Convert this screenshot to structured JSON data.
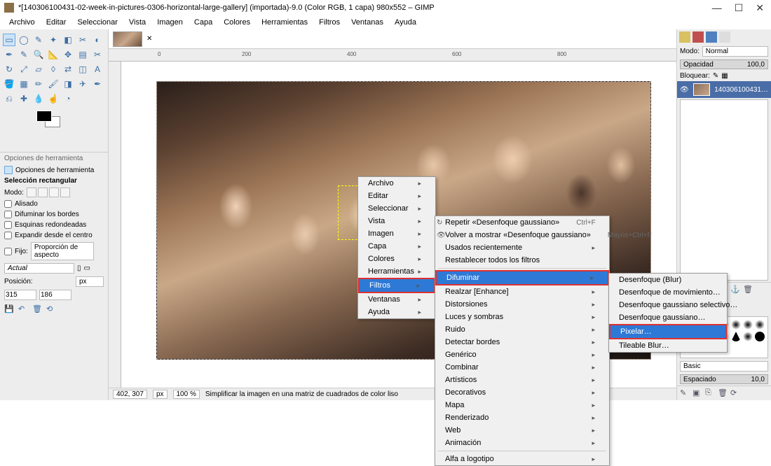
{
  "window": {
    "title": "*[140306100431-02-week-in-pictures-0306-horizontal-large-gallery] (importada)-9.0 (Color RGB, 1 capa) 980x552 – GIMP"
  },
  "menubar": [
    "Archivo",
    "Editar",
    "Seleccionar",
    "Vista",
    "Imagen",
    "Capa",
    "Colores",
    "Herramientas",
    "Filtros",
    "Ventanas",
    "Ayuda"
  ],
  "tool_options": {
    "header": "Opciones de herramienta",
    "tab": "Opciones de herramienta",
    "section": "Selección rectangular",
    "mode_label": "Modo:",
    "antialias": "Alisado",
    "feather": "Difuminar los bordes",
    "rounded": "Esquinas redondeadas",
    "expand": "Expandir desde el centro",
    "fixed_label": "Fijo:",
    "fixed_value": "Proporción de aspecto",
    "current": "Actual",
    "position_label": "Posición:",
    "unit": "px",
    "pos_x": "315",
    "pos_y": "186"
  },
  "status": {
    "coords": "402, 307",
    "unit": "px",
    "zoom": "100 %",
    "hint": "Simplificar la imagen en una matriz de cuadrados de color liso"
  },
  "right": {
    "mode_label": "Modo:",
    "mode_value": "Normal",
    "opacity_label": "Opacidad",
    "opacity_value": "100,0",
    "lock_label": "Bloquear:",
    "layer_name": "140306100431…",
    "brush_set": "Basic",
    "spacing_label": "Espaciado",
    "spacing_value": "10,0"
  },
  "ctx1": {
    "items": [
      "Archivo",
      "Editar",
      "Seleccionar",
      "Vista",
      "Imagen",
      "Capa",
      "Colores",
      "Herramientas",
      "Filtros",
      "Ventanas",
      "Ayuda"
    ],
    "highlighted": "Filtros"
  },
  "ctx2": {
    "repeat": "Repetir «Desenfoque gaussiano»",
    "repeat_sc": "Ctrl+F",
    "reshow": "Volver a mostrar «Desenfoque gaussiano»",
    "reshow_sc": "Mayús+Ctrl+F",
    "recent": "Usados recientemente",
    "reset": "Restablecer todos los filtros",
    "blur": "Difuminar",
    "enhance": "Realzar [Enhance]",
    "distorts": "Distorsiones",
    "light": "Luces y sombras",
    "noise": "Ruido",
    "edge": "Detectar bordes",
    "generic": "Genérico",
    "combine": "Combinar",
    "artistic": "Artísticos",
    "decor": "Decorativos",
    "map": "Mapa",
    "render": "Renderizado",
    "web": "Web",
    "anim": "Animación",
    "alpha": "Alfa a logotipo"
  },
  "ctx3": {
    "blur": "Desenfoque (Blur)",
    "motion": "Desenfoque de movimiento…",
    "selgauss": "Desenfoque gaussiano selectivo…",
    "gauss": "Desenfoque gaussiano…",
    "pixelize": "Pixelar…",
    "tileable": "Tileable Blur…"
  }
}
